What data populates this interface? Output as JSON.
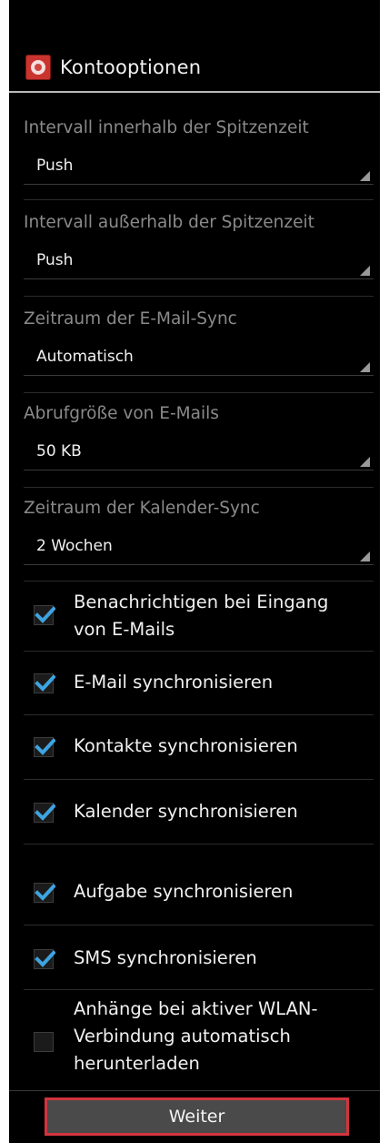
{
  "header": {
    "title": "Kontooptionen",
    "icon": "mail-app-icon"
  },
  "spinners": [
    {
      "label": "Intervall innerhalb der Spitzenzeit",
      "value": "Push"
    },
    {
      "label": "Intervall außerhalb der Spitzenzeit",
      "value": "Push"
    },
    {
      "label": "Zeitraum der E-Mail-Sync",
      "value": "Automatisch"
    },
    {
      "label": "Abrufgröße von E-Mails",
      "value": "50 KB"
    },
    {
      "label": "Zeitraum der Kalender-Sync",
      "value": "2 Wochen"
    }
  ],
  "checkboxes": [
    {
      "label": "Benachrichtigen bei Eingang von E-Mails",
      "checked": true
    },
    {
      "label": "E-Mail synchronisieren",
      "checked": true
    },
    {
      "label": "Kontakte synchronisieren",
      "checked": true
    },
    {
      "label": "Kalender synchronisieren",
      "checked": true
    },
    {
      "label": "Aufgabe synchronisieren",
      "checked": true
    },
    {
      "label": "SMS synchronisieren",
      "checked": true
    },
    {
      "label": "Anhänge bei aktiver WLAN-Verbindung automatisch herunterladen",
      "checked": false
    }
  ],
  "footer": {
    "next_label": "Weiter"
  },
  "colors": {
    "checkmark": "#3ea3e0",
    "highlight_border": "#d2343e",
    "background": "#000000"
  }
}
